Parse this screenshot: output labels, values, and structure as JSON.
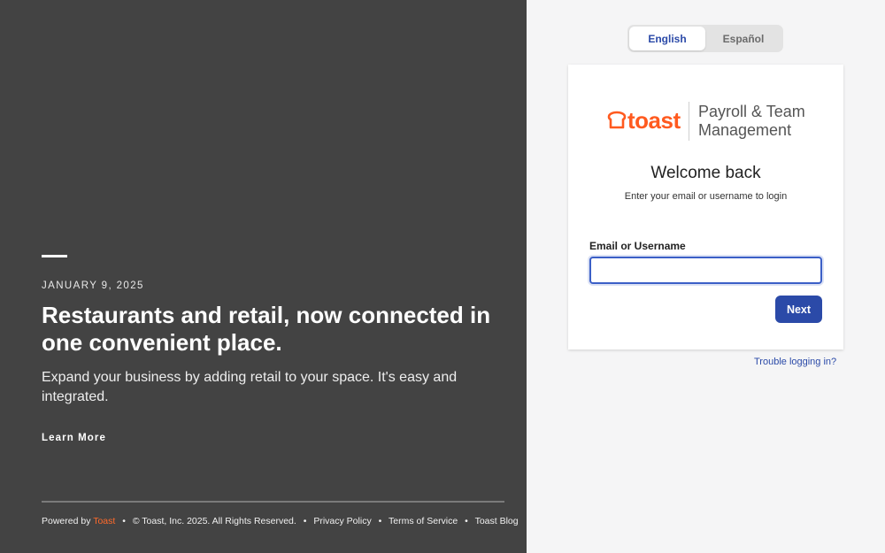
{
  "promo": {
    "date": "JANUARY 9, 2025",
    "headline": "Restaurants and retail, now connected in one convenient place.",
    "subtext": "Expand your business by adding retail to your space. It's easy and integrated.",
    "learn_more": "Learn More"
  },
  "footer": {
    "powered_by": "Powered by",
    "brand": "Toast",
    "copyright": "© Toast, Inc.  2025.  All Rights Reserved.",
    "privacy": "Privacy Policy",
    "terms": "Terms of Service",
    "blog": "Toast Blog",
    "separator": "•"
  },
  "language": {
    "english": "English",
    "spanish": "Español",
    "selected": "English"
  },
  "login": {
    "logo_text": "toast",
    "product_line1": "Payroll & Team",
    "product_line2": "Management",
    "welcome": "Welcome back",
    "instruction": "Enter your email or username to login",
    "field_label": "Email or Username",
    "field_value": "",
    "next_label": "Next",
    "trouble_link": "Trouble logging in?"
  },
  "colors": {
    "left_panel_bg": "#434343",
    "brand_orange": "#ff5a1f",
    "accent_blue": "#2b4aa8"
  }
}
